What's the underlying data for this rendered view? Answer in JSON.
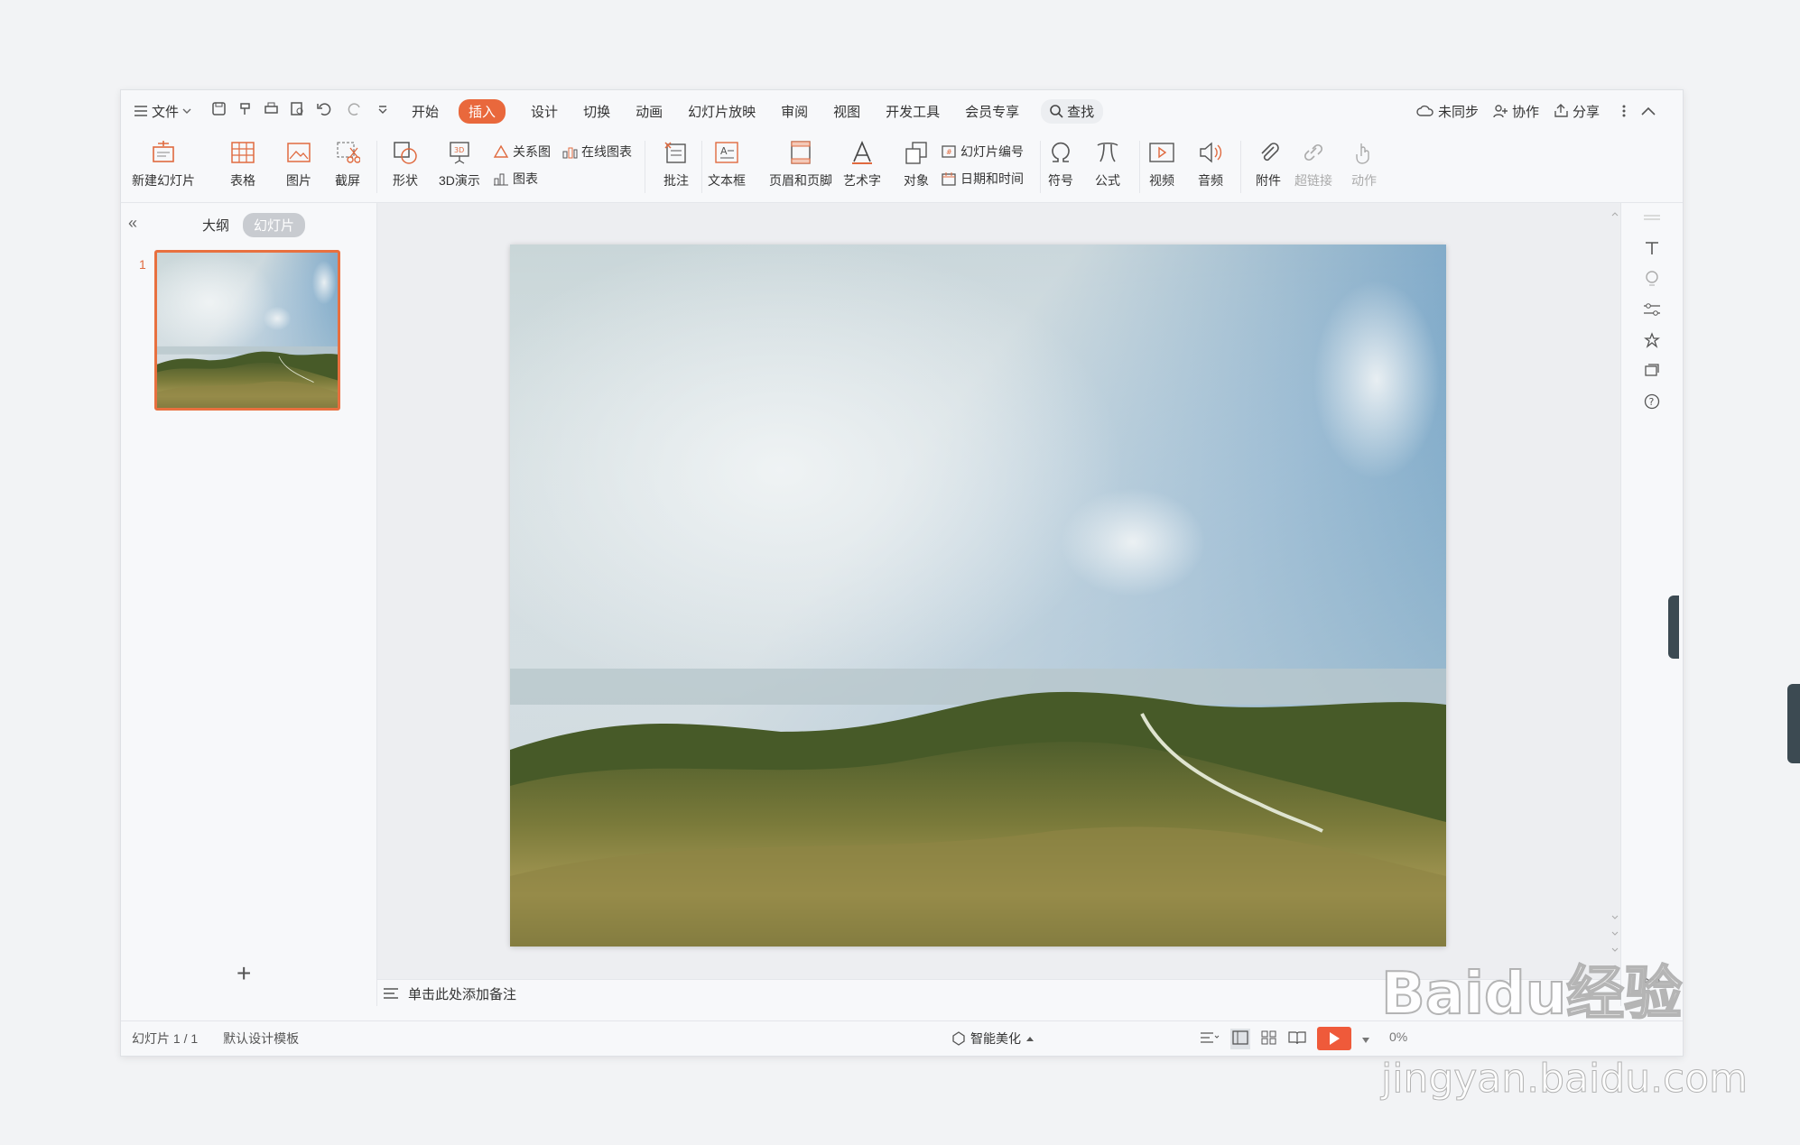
{
  "menubar": {
    "file_label": "文件",
    "tabs": [
      "开始",
      "插入",
      "设计",
      "切换",
      "动画",
      "幻灯片放映",
      "审阅",
      "视图",
      "开发工具",
      "会员专享"
    ],
    "active_tab": "插入",
    "search_label": "查找",
    "right": {
      "sync": "未同步",
      "collab": "协作",
      "share": "分享"
    }
  },
  "ribbon": {
    "new_slide": "新建幻灯片",
    "table": "表格",
    "picture": "图片",
    "screenshot": "截屏",
    "shape": "形状",
    "demo3d": "3D演示",
    "relation": "关系图",
    "online_chart": "在线图表",
    "chart": "图表",
    "comment": "批注",
    "textbox": "文本框",
    "header_footer": "页眉和页脚",
    "art_text": "艺术字",
    "object": "对象",
    "slide_number": "幻灯片编号",
    "date_time": "日期和时间",
    "symbol": "符号",
    "formula": "公式",
    "video": "视频",
    "audio": "音频",
    "attachment": "附件",
    "hyperlink": "超链接",
    "action": "动作"
  },
  "left_panel": {
    "outline_tab": "大纲",
    "slides_tab": "幻灯片",
    "slide_number": "1"
  },
  "notes": {
    "placeholder": "单击此处添加备注"
  },
  "statusbar": {
    "slide_info": "幻灯片 1 / 1",
    "template": "默认设计模板",
    "beautify": "智能美化",
    "zoom": "0%"
  },
  "watermark": {
    "brand": "Baidu经验",
    "url": "jingyan.baidu.com"
  },
  "colors": {
    "accent": "#e9683c",
    "play": "#ef5a3a"
  }
}
